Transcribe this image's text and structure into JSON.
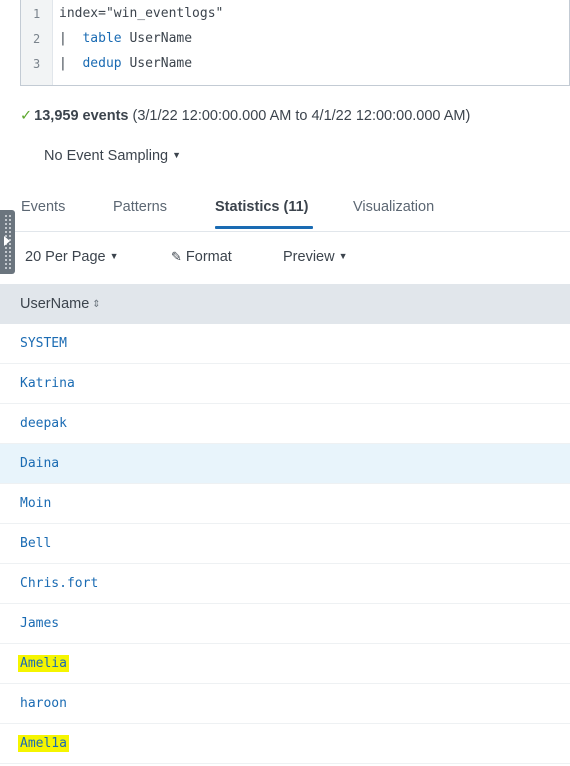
{
  "query": {
    "lines": [
      {
        "num": "1",
        "pipe": "",
        "kw": "",
        "rest": "index=\"win_eventlogs\""
      },
      {
        "num": "2",
        "pipe": "| ",
        "kw": "table",
        "rest": " UserName"
      },
      {
        "num": "3",
        "pipe": "| ",
        "kw": "dedup",
        "rest": " UserName"
      }
    ]
  },
  "summary": {
    "check": "✓",
    "count": "13,959 events",
    "range": " (3/1/22 12:00:00.000 AM to 4/1/22 12:00:00.000 AM)"
  },
  "sampling": {
    "label": "No Event Sampling"
  },
  "tabs": {
    "events": "Events",
    "patterns": "Patterns",
    "statistics": "Statistics (11)",
    "visualization": "Visualization"
  },
  "toolbar": {
    "per_page": "20 Per Page",
    "format": "Format",
    "preview": "Preview"
  },
  "table": {
    "column": "UserName",
    "rows": [
      {
        "value": "SYSTEM",
        "highlight": false
      },
      {
        "value": "Katrina",
        "highlight": false
      },
      {
        "value": "deepak",
        "highlight": false
      },
      {
        "value": "Daina",
        "highlight": false
      },
      {
        "value": "Moin",
        "highlight": false
      },
      {
        "value": "Bell",
        "highlight": false
      },
      {
        "value": "Chris.fort",
        "highlight": false
      },
      {
        "value": "James",
        "highlight": false
      },
      {
        "value": "Amelia",
        "highlight": true
      },
      {
        "value": "haroon",
        "highlight": false
      },
      {
        "value": "Amel1a",
        "highlight": true
      }
    ]
  },
  "colors": {
    "accent": "#1a6bb3",
    "highlight": "#f5f500",
    "success": "#5ca72d",
    "header_bg": "#e1e6eb"
  }
}
